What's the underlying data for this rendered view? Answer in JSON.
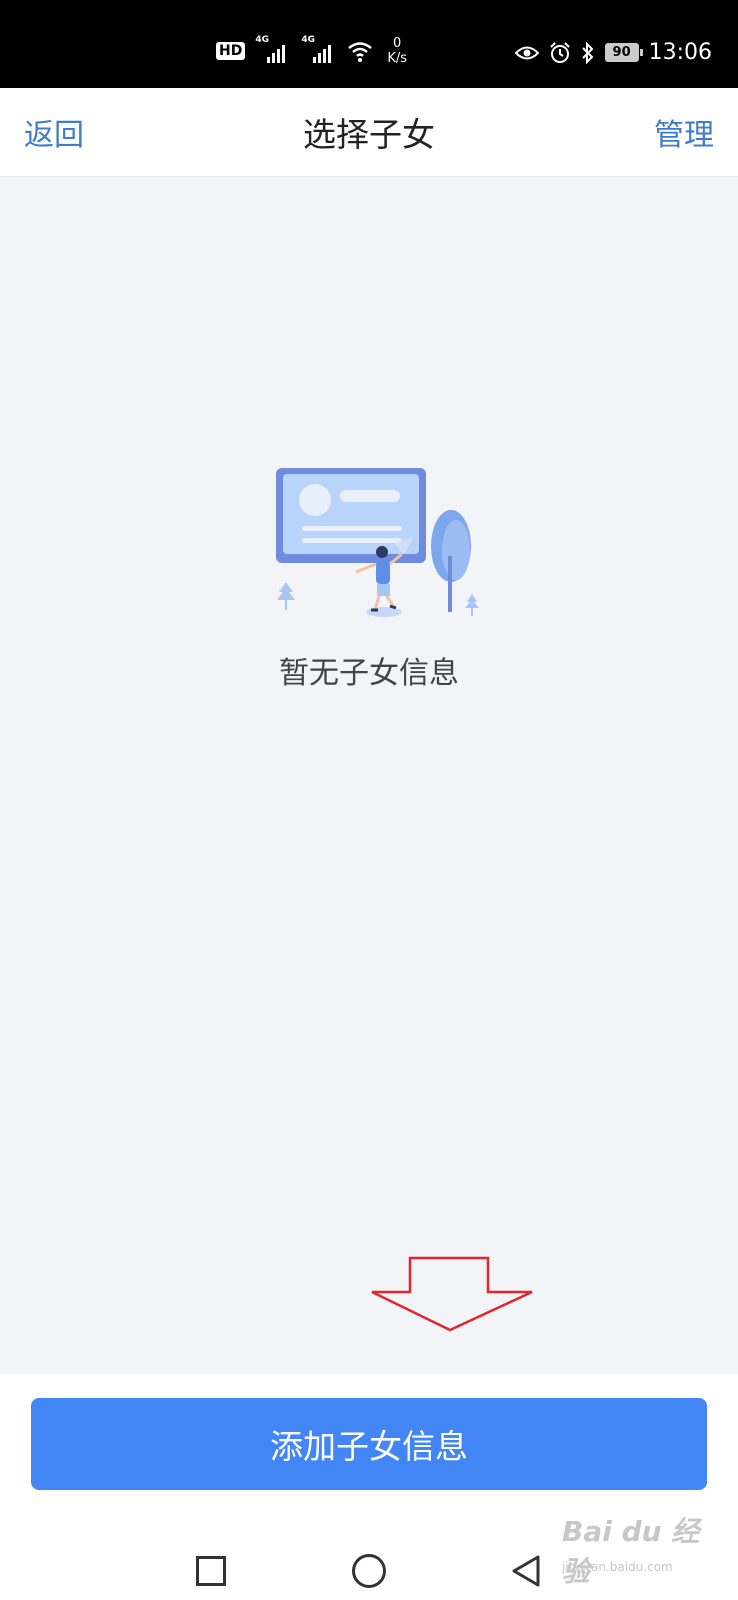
{
  "status_bar": {
    "hd_label": "HD",
    "network_tag": "4G",
    "speed_value": "0",
    "speed_unit": "K/s",
    "battery_level": "90",
    "time": "13:06",
    "icons": [
      "signal-icon",
      "wifi-icon",
      "eye-icon",
      "alarm-icon",
      "bluetooth-icon",
      "battery-icon"
    ]
  },
  "nav": {
    "back_label": "返回",
    "title": "选择子女",
    "manage_label": "管理"
  },
  "empty_state": {
    "illustration": "empty-profile-illustration",
    "message": "暂无子女信息"
  },
  "annotation": {
    "arrow_icon": "red-down-arrow-icon",
    "color": "#e0262b"
  },
  "actions": {
    "add_button_label": "添加子女信息",
    "button_color": "#4285f4"
  },
  "system_nav": {
    "icons": [
      "recent-apps-icon",
      "home-icon",
      "back-triangle-icon"
    ]
  },
  "watermark": {
    "main": "Bai du 经验",
    "sub": "jingyan.baidu.com"
  }
}
